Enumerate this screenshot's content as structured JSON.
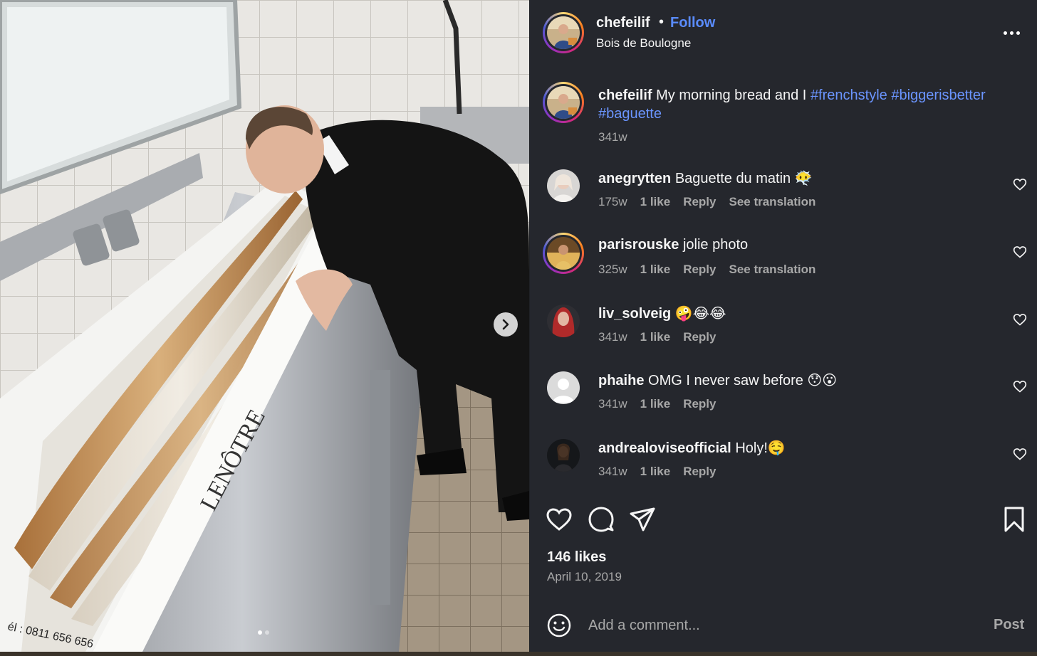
{
  "post": {
    "username": "chefeilif",
    "separator": "•",
    "follow_label": "Follow",
    "location": "Bois de Boulogne",
    "more_icon": "more-horizontal-icon"
  },
  "caption": {
    "username": "chefeilif",
    "text": "My morning bread and I",
    "hashtags": [
      "#frenchstyle",
      "#biggerisbetter",
      "#baguette"
    ],
    "time": "341w"
  },
  "comments": [
    {
      "username": "anegrytten",
      "text": "Baguette du matin 😶‍🌫️",
      "time": "175w",
      "likes": "1 like",
      "reply": "Reply",
      "translate": "See translation"
    },
    {
      "username": "parisrouske",
      "text": "jolie photo",
      "time": "325w",
      "likes": "1 like",
      "reply": "Reply",
      "translate": "See translation"
    },
    {
      "username": "liv_solveig",
      "text": "🤪😂😂",
      "time": "341w",
      "likes": "1 like",
      "reply": "Reply"
    },
    {
      "username": "phaihe",
      "text": "OMG I never saw before 😯😮",
      "time": "341w",
      "likes": "1 like",
      "reply": "Reply"
    },
    {
      "username": "andrealoviseofficial",
      "text": "Holy!🤤",
      "time": "341w",
      "likes": "1 like",
      "reply": "Reply"
    }
  ],
  "stats": {
    "likes": "146 likes",
    "date": "April 10, 2019"
  },
  "composer": {
    "placeholder": "Add a comment...",
    "post_label": "Post"
  },
  "carousel": {
    "slides": 2,
    "active": 1
  },
  "colors": {
    "panel_bg": "#25272d",
    "link_blue": "#5a8cff",
    "muted": "#a8a8a8"
  }
}
